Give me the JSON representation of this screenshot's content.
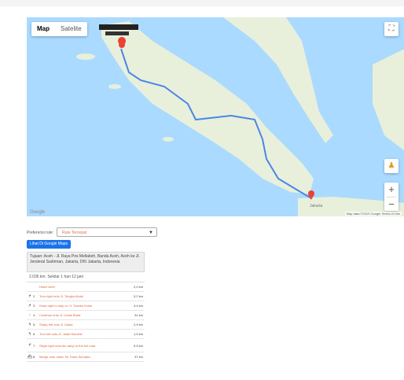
{
  "map": {
    "type_options": [
      "Map",
      "Satelite"
    ],
    "active_type": "Map",
    "fullscreen_icon": "fullscreen-icon",
    "pegman_icon": "pegman-icon",
    "zoom_in": "+",
    "zoom_out": "−",
    "google_text": "Google",
    "attribution": "Map data ©2019 Google  Terms of Use",
    "destination_label": "Jakarta",
    "origin_marker": "A",
    "destination_marker": "B",
    "colors": {
      "water": "#aadaff",
      "land": "#e8f0dc",
      "route": "#4a86e8",
      "marker": "#ea4335"
    }
  },
  "controls": {
    "preference_label": "Preferensi rute:",
    "preference_value": "Rute Tercepat",
    "open_button": "Lihat Di Google Maps"
  },
  "directions": {
    "summary": "Tujuan: Aceh - Jl. Raya Pos Mellaboh, Banda Aceh, Aceh ke Jl. Jenderal Sudirman, Jakarta, DKI Jakarta, Indonesia",
    "distance": "2.036 km. Sekitar 1 hari 12 jam",
    "steps": [
      {
        "icon": "",
        "num": "",
        "text": "Head north",
        "d": "2,0 km"
      },
      {
        "icon": "↱",
        "num": "2.",
        "text": "Turn right onto Jl. Tengku Abdul",
        "d": "3,2 km"
      },
      {
        "icon": "↱",
        "num": "3.",
        "text": "Keep right to stay on Jl. Tuanku Imam",
        "d": "4,4 km"
      },
      {
        "icon": "↑",
        "num": "4.",
        "text": "Continue onto Jl. Lintas Barat",
        "d": "31 km"
      },
      {
        "icon": "↰",
        "num": "5.",
        "text": "Sharp left onto Jl. Dalas",
        "d": "2,9 km"
      },
      {
        "icon": "↰",
        "num": "6.",
        "text": "Turn left onto Jl. Jalan Ramelis",
        "d": "1,5 km"
      },
      {
        "icon": "↱",
        "num": "7.",
        "text": "Slight right onto the ramp to the toll road",
        "d": "0,9 km"
      },
      {
        "icon": "⛴",
        "num": "8.",
        "text": "Merge onto Jalan Tol Trans-Sumatra",
        "d": "37 km"
      }
    ]
  }
}
